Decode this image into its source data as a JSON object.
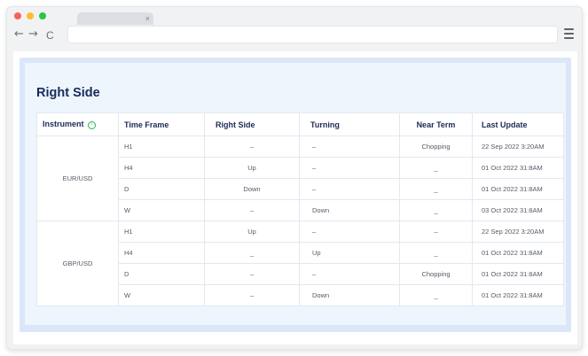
{
  "browser": {
    "tab_close": "×",
    "nav": {
      "back": "←",
      "forward": "→",
      "reload": "C"
    }
  },
  "panel": {
    "title": "Right Side"
  },
  "table": {
    "headers": {
      "instrument": "Instrument",
      "time_frame": "Time Frame",
      "right_side": "Right Side",
      "turning": "Turning",
      "near_term": "Near Term",
      "last_update": "Last Update"
    },
    "info_icon": "↑",
    "groups": [
      {
        "instrument": "EUR/USD",
        "rows": [
          {
            "time_frame": "H1",
            "right_side": "–",
            "turning": "–",
            "near_term": "Chopping",
            "last_update": "22 Sep 2022 3:20AM"
          },
          {
            "time_frame": "H4",
            "right_side": "Up",
            "turning": "–",
            "near_term": "_",
            "last_update": "01 Oct 2022 31:8AM"
          },
          {
            "time_frame": "D",
            "right_side": "Down",
            "turning": "–",
            "near_term": "_",
            "last_update": "01 Oct 2022 31:8AM"
          },
          {
            "time_frame": "W",
            "right_side": "–",
            "turning": "Down",
            "near_term": "_",
            "last_update": "03 Oct 2022 31:8AM"
          }
        ]
      },
      {
        "instrument": "GBP/USD",
        "rows": [
          {
            "time_frame": "H1",
            "right_side": "Up",
            "turning": "–",
            "near_term": "–",
            "last_update": "22 Sep 2022 3:20AM"
          },
          {
            "time_frame": "H4",
            "right_side": "_",
            "turning": "Up",
            "near_term": "_",
            "last_update": "01 Oct 2022 31:8AM"
          },
          {
            "time_frame": "D",
            "right_side": "–",
            "turning": "–",
            "near_term": "Chopping",
            "last_update": "01 Oct 2022 31:8AM"
          },
          {
            "time_frame": "W",
            "right_side": "–",
            "turning": "Down",
            "near_term": "_",
            "last_update": "01 Oct 2022 31:8AM"
          }
        ]
      }
    ]
  }
}
